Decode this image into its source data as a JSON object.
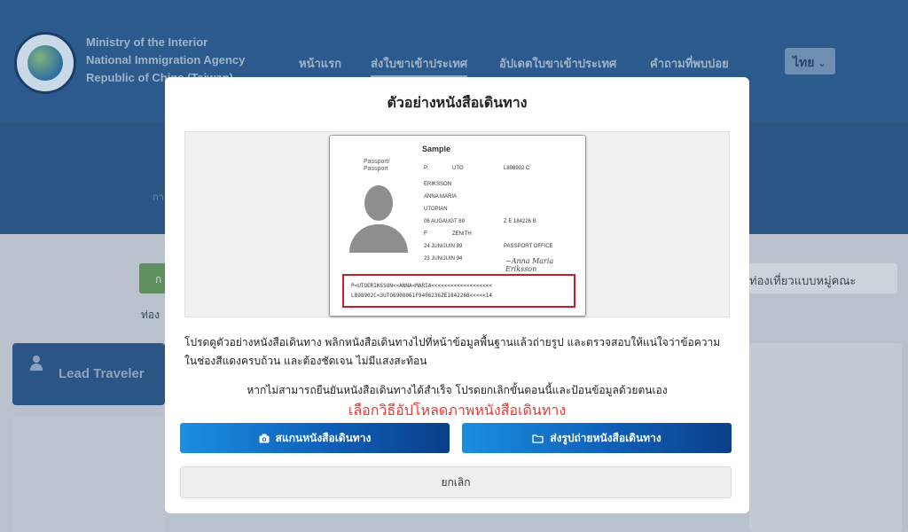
{
  "header": {
    "agency_lines": [
      "Ministry of the Interior",
      "National Immigration Agency",
      "Republic of China (Taiwan)"
    ],
    "nav": [
      "หน้าแรก",
      "ส่งใบขาเข้าประเทศ",
      "อัปเดตใบขาเข้าประเทศ",
      "คำถามที่พบบ่อย"
    ],
    "language": "ไทย"
  },
  "background": {
    "band_text": "กา",
    "group_tab": "ท่องเที่ยวแบบหมู่คณะ",
    "green_tab": "ก",
    "small_text": "ท่อง",
    "lead_traveler": "Lead Traveler"
  },
  "modal": {
    "title": "ตัวอย่างหนังสือเดินทาง",
    "instruction_line1": "โปรดดูตัวอย่างหนังสือเดินทาง พลิกหนังสือเดินทางไปที่หน้าข้อมูลพื้นฐานแล้วถ่ายรูป และตรวจสอบให้แน่ใจว่าข้อความ",
    "instruction_line2": "ในช่องสีแดงครบถ้วน และต้องชัดเจน ไม่มีแสงสะท้อน",
    "fail_text": "หากไม่สามารถยืนยันหนังสือเดินทางได้สำเร็จ โปรดยกเลิกขั้นตอนนี้และป้อนข้อมูลด้วยตนเอง",
    "choose_text": "เลือกวิธีอัปโหลดภาพหนังสือเดินทาง",
    "scan_button": "สแกนหนังสือเดินทาง",
    "upload_button": "ส่งรูปถ่ายหนังสือเดินทาง",
    "cancel_button": "ยกเลิก",
    "passport": {
      "sample": "Sample",
      "type_label": "Passport/\nPassport",
      "type": "P",
      "country_code": "UTO",
      "passport_no": "L898902 C",
      "surname": "ERIKSSON",
      "given_names": "ANNA MARIA",
      "nationality": "UTOPIAN",
      "dob": "06 AUGAUGT 69",
      "personal_no": "Z E 184226 B",
      "sex": "F",
      "place_of_birth": "ZENITH",
      "date_of_issue": "24 JUN/JUIN 89",
      "authority": "PASSPORT OFFICE",
      "date_of_expiry": "23 JUN/JUIN 94",
      "mrz_line1": "P<UTOERIKSSON<<ANNA<MARIA<<<<<<<<<<<<<<<<<<<",
      "mrz_line2": "L898902C<3UTO6908061F9406236ZE184226B<<<<<14"
    }
  },
  "colors": {
    "header_bg": "#2c5a8c",
    "button_gradient_start": "#1a8fe0",
    "button_gradient_end": "#0a3f8a",
    "accent_red": "#e53935"
  }
}
